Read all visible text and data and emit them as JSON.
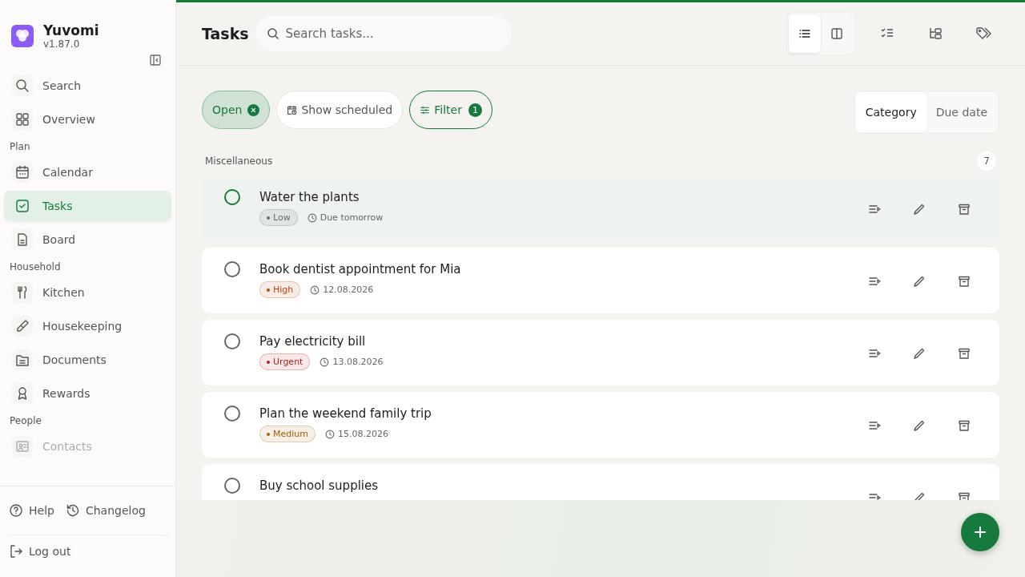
{
  "app": {
    "name": "Yuvomi",
    "version": "v1.87.0"
  },
  "sidebar": {
    "sections": [
      {
        "items": [
          {
            "label": "Search",
            "selected": false,
            "disabled": false
          },
          {
            "label": "Overview",
            "selected": false,
            "disabled": false
          }
        ]
      },
      {
        "title": "Plan",
        "items": [
          {
            "label": "Calendar",
            "selected": false,
            "disabled": false
          },
          {
            "label": "Tasks",
            "selected": true,
            "disabled": false
          },
          {
            "label": "Board",
            "selected": false,
            "disabled": false
          }
        ]
      },
      {
        "title": "Household",
        "items": [
          {
            "label": "Kitchen",
            "selected": false,
            "disabled": false
          },
          {
            "label": "Housekeeping",
            "selected": false,
            "disabled": false
          },
          {
            "label": "Documents",
            "selected": false,
            "disabled": false
          },
          {
            "label": "Rewards",
            "selected": false,
            "disabled": false
          }
        ]
      },
      {
        "title": "People",
        "items": [
          {
            "label": "Contacts",
            "selected": false,
            "disabled": true
          }
        ]
      }
    ],
    "footer_links": [
      "Help",
      "Changelog"
    ],
    "logout": "Log out"
  },
  "header": {
    "title": "Tasks",
    "search": {
      "placeholder": "Search tasks..."
    },
    "view_toggle": [
      {
        "selected": true
      },
      {
        "selected": false
      }
    ]
  },
  "filters": [
    {
      "label": "Open",
      "kind": "active"
    },
    {
      "label": "Show scheduled",
      "kind": "toggle"
    },
    {
      "label": "Filter",
      "kind": "filter",
      "count": "1"
    }
  ],
  "group_by": [
    {
      "label": "Category",
      "selected": true
    },
    {
      "label": "Due date",
      "selected": false
    }
  ],
  "group": {
    "title": "Miscellaneous",
    "count": "7"
  },
  "tasks": [
    {
      "title": "Water the plants",
      "priority": "Low",
      "color": "#6b6b6b",
      "due": "Due tomorrow",
      "selected": true
    },
    {
      "title": "Book dentist appointment for Mia",
      "priority": "High",
      "color": "#c2410c",
      "due": "12.08.2026",
      "selected": false
    },
    {
      "title": "Pay electricity bill",
      "priority": "Urgent",
      "color": "#b91c1c",
      "due": "13.08.2026",
      "selected": false
    },
    {
      "title": "Plan the weekend family trip",
      "priority": "Medium",
      "color": "#a16207",
      "due": "15.08.2026",
      "selected": false
    },
    {
      "title": "Buy school supplies",
      "selected": false
    }
  ]
}
